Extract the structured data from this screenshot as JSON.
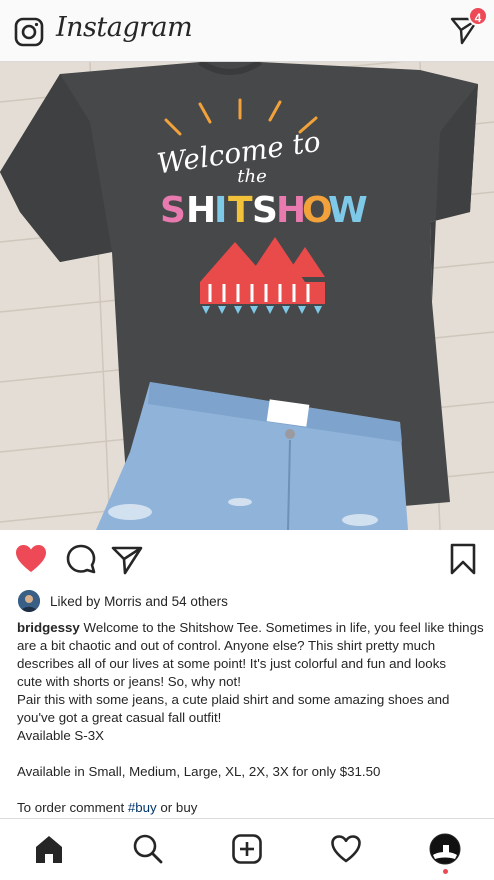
{
  "header": {
    "app_name": "Instagram",
    "dm_badge_count": "4",
    "camera_icon": "camera-icon",
    "dm_icon": "direct-message-icon"
  },
  "post": {
    "image_description_icon": "tshirt-shorts-photo",
    "shirt_text": {
      "line1": "Welcome to",
      "line2": "the",
      "line3": "SHITSHOW"
    },
    "liked": true,
    "likes": {
      "prefix": "Liked by",
      "user": "Morris",
      "connector": "and",
      "others": "54 others"
    },
    "caption": {
      "username": "bridgessy",
      "lines": [
        "Welcome to the Shitshow Tee. Sometimes in life, you feel like things",
        "are a bit chaotic and out of control.  Anyone else?  This shirt pretty much",
        "describes all of our lives at some point!  It's just colorful and fun and looks",
        "cute with shorts or jeans!  So, why not!",
        "Pair this with some jeans, a cute plaid shirt and some amazing shoes and",
        "you've got a great casual fall outfit!",
        "Available S-3X"
      ],
      "line0_rest": "Welcome to the Shitshow Tee. Sometimes in life, you feel like things",
      "sizes_line": "Available in Small, Medium, Large, XL, 2X, 3X for only $31.50",
      "order_prefix": "To order comment",
      "order_hashtag": "#buy",
      "order_suffix": "or buy"
    }
  },
  "colors": {
    "like_red": "#ed4956",
    "text": "#262626",
    "hashtag": "#003569",
    "border": "#dbdbdb"
  },
  "bottom_nav": {
    "items": [
      "home-icon",
      "search-icon",
      "new-post-icon",
      "activity-heart-icon",
      "profile-avatar"
    ]
  }
}
